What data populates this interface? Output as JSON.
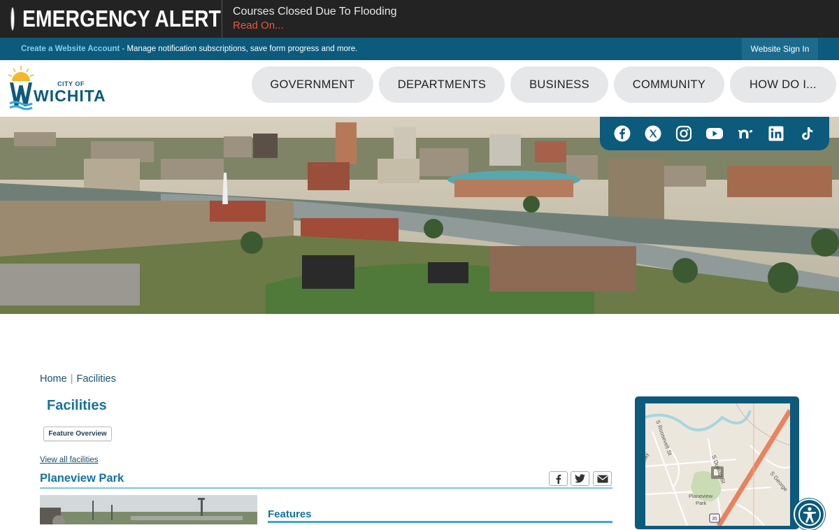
{
  "alert": {
    "title": "EMERGENCY ALERT",
    "message": "Courses Closed Due To Flooding",
    "link": "Read On...",
    "colors": {
      "bar": "#232323",
      "indicator": "#e1251b",
      "link": "#e8573f"
    }
  },
  "account_bar": {
    "create_link": "Create a Website Account",
    "description": " - Manage notification subscriptions, save form progress and more.",
    "sign_in": "Website Sign In",
    "color": "#0c5a7c"
  },
  "logo": {
    "small_text": "CITY OF",
    "name": "WICHITA"
  },
  "nav": {
    "items": [
      {
        "label": "GOVERNMENT"
      },
      {
        "label": "DEPARTMENTS"
      },
      {
        "label": "BUSINESS"
      },
      {
        "label": "COMMUNITY"
      },
      {
        "label": "HOW DO I..."
      }
    ]
  },
  "social": [
    "facebook-icon",
    "x-icon",
    "instagram-icon",
    "youtube-icon",
    "nextdoor-icon",
    "linkedin-icon",
    "tiktok-icon"
  ],
  "breadcrumb": {
    "home": "Home",
    "separator": "|",
    "current": "Facilities"
  },
  "page": {
    "title": "Facilities",
    "feature_overview": "Feature Overview",
    "view_all": "View all facilities",
    "facility_name": "Planeview Park",
    "features_heading": "Features"
  },
  "map": {
    "labels": [
      "S Roosevelt St",
      "S Dunlap St",
      "S George",
      "Planeview Park",
      "35",
      "way"
    ]
  }
}
